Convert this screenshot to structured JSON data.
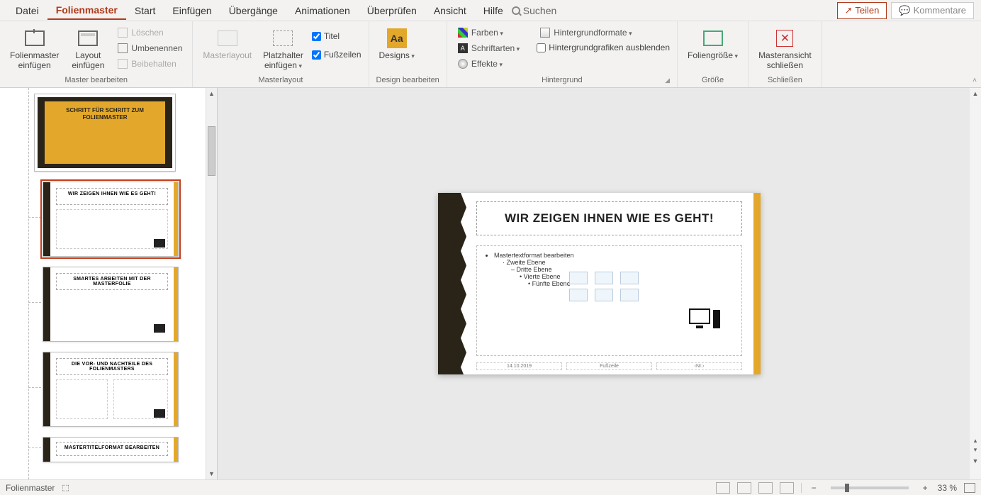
{
  "menu": {
    "tabs": [
      "Datei",
      "Folienmaster",
      "Start",
      "Einfügen",
      "Übergänge",
      "Animationen",
      "Überprüfen",
      "Ansicht",
      "Hilfe"
    ],
    "active_index": 1,
    "search_placeholder": "Suchen",
    "share": "Teilen",
    "comments": "Kommentare"
  },
  "ribbon": {
    "groups": {
      "master_edit": {
        "label": "Master bearbeiten",
        "insert_master": "Folienmaster\neinfügen",
        "insert_layout": "Layout\neinfügen",
        "delete": "Löschen",
        "rename": "Umbenennen",
        "preserve": "Beibehalten"
      },
      "master_layout": {
        "label": "Masterlayout",
        "master_layout_btn": "Masterlayout",
        "insert_placeholder": "Platzhalter\neinfügen",
        "chk_title": "Titel",
        "chk_footers": "Fußzeilen",
        "title_checked": true,
        "footers_checked": true
      },
      "edit_design": {
        "label": "Design bearbeiten",
        "designs": "Designs"
      },
      "background": {
        "label": "Hintergrund",
        "colors": "Farben",
        "fonts": "Schriftarten",
        "effects": "Effekte",
        "bg_formats": "Hintergrundformate",
        "hide_bg_graphics": "Hintergrundgrafiken ausblenden",
        "hide_checked": false
      },
      "size": {
        "label": "Größe",
        "slide_size": "Foliengröße"
      },
      "close": {
        "label": "Schließen",
        "close_master": "Masteransicht\nschließen"
      }
    }
  },
  "thumbnails": {
    "master_title": "SCHRITT FÜR SCHRITT ZUM FOLIENMASTER",
    "layouts": [
      {
        "title": "WIR ZEIGEN IHNEN WIE ES GEHT!",
        "selected": true
      },
      {
        "title": "SMARTES ARBEITEN MIT DER MASTERFOLIE",
        "selected": false
      },
      {
        "title": "DIE VOR- UND NACHTEILE DES FOLIENMASTERS",
        "selected": false
      },
      {
        "title": "MASTERTITELFORMAT BEARBEITEN",
        "selected": false
      }
    ]
  },
  "slide": {
    "title": "WIR ZEIGEN IHNEN WIE ES GEHT!",
    "bullets": {
      "l1": "Mastertextformat bearbeiten",
      "l2": "Zweite Ebene",
      "l3": "Dritte Ebene",
      "l4": "Vierte Ebene",
      "l5": "Fünfte Ebene"
    },
    "footer_date": "14.10.2019",
    "footer_text": "Fußzeile",
    "footer_num": "‹Nr.›"
  },
  "status": {
    "mode": "Folienmaster",
    "zoom": "33 %"
  }
}
